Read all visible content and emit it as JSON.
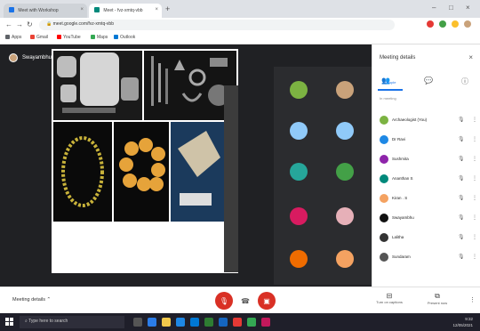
{
  "browser": {
    "tabs": [
      {
        "label": "Meet with Workshop",
        "favicon_color": "#1a73e8"
      },
      {
        "label": "Meet - fvz-xmtq-vbb",
        "favicon_color": "#00897b"
      }
    ],
    "url": "meet.google.com/fvz-xmtq-vbb",
    "bookmarks": [
      "Apps",
      "Gmail",
      "YouTube",
      "Maps",
      "Outlook"
    ]
  },
  "presenter": {
    "label": "Swayambhu is presenting"
  },
  "side_panel": {
    "title": "Meeting details",
    "active_tab_label": "People",
    "section_label": "In meeting",
    "participants": [
      {
        "name": "Archaeologist (You)",
        "color": "#7cb342"
      },
      {
        "name": "Dr Ravi",
        "color": "#1e88e5"
      },
      {
        "name": "Sushmita",
        "color": "#8e24aa"
      },
      {
        "name": "Ananthan S",
        "color": "#00897b"
      },
      {
        "name": "Kiran . S",
        "color": "#f4a261"
      },
      {
        "name": "Swayambhu",
        "color": "#111111"
      },
      {
        "name": "Lalitha",
        "color": "#333333"
      },
      {
        "name": "Sundaram",
        "color": "#555555"
      }
    ]
  },
  "bottom_bar": {
    "meeting_details_label": "Meeting details",
    "actions": [
      {
        "label": "Turn on captions"
      },
      {
        "label": "Present now"
      }
    ]
  },
  "taskbar": {
    "search_placeholder": "Type here to search",
    "time": "9:32",
    "date": "12/05/2021"
  }
}
